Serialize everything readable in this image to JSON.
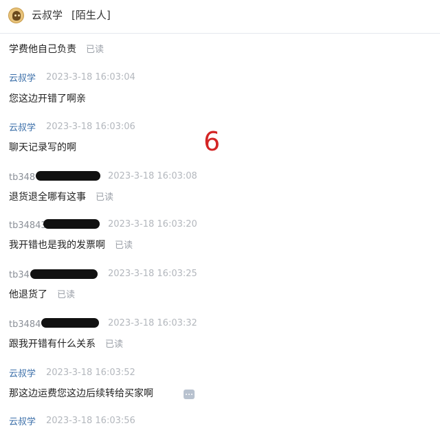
{
  "header": {
    "contact_name": "云叔学",
    "contact_tag": "[陌生人]"
  },
  "overlay_number": "6",
  "messages": [
    {
      "text": "学费他自己负责",
      "status": "已读"
    },
    {
      "sender": "云叔学",
      "time": "2023-3-18 16:03:04",
      "text": "您这边开错了啊亲"
    },
    {
      "sender": "云叔学",
      "time": "2023-3-18 16:03:06",
      "text": "聊天记录写的啊"
    },
    {
      "sender": "tb348",
      "time": "2023-3-18 16:03:08",
      "text": "退货退全哪有这事",
      "status": "已读"
    },
    {
      "sender": "tb34843",
      "time": "2023-3-18 16:03:20",
      "text": "我开错也是我的发票啊",
      "status": "已读"
    },
    {
      "sender": "tb34",
      "time": "2023-3-18 16:03:25",
      "text": "他退货了",
      "status": "已读"
    },
    {
      "sender": "tb3484",
      "time": "2023-3-18 16:03:32",
      "text": "跟我开错有什么关系",
      "status": "已读"
    },
    {
      "sender": "云叔学",
      "time": "2023-3-18 16:03:52",
      "text": "那这边运费您这边后续转给买家啊"
    },
    {
      "sender": "云叔学",
      "time": "2023-3-18 16:03:56"
    }
  ]
}
